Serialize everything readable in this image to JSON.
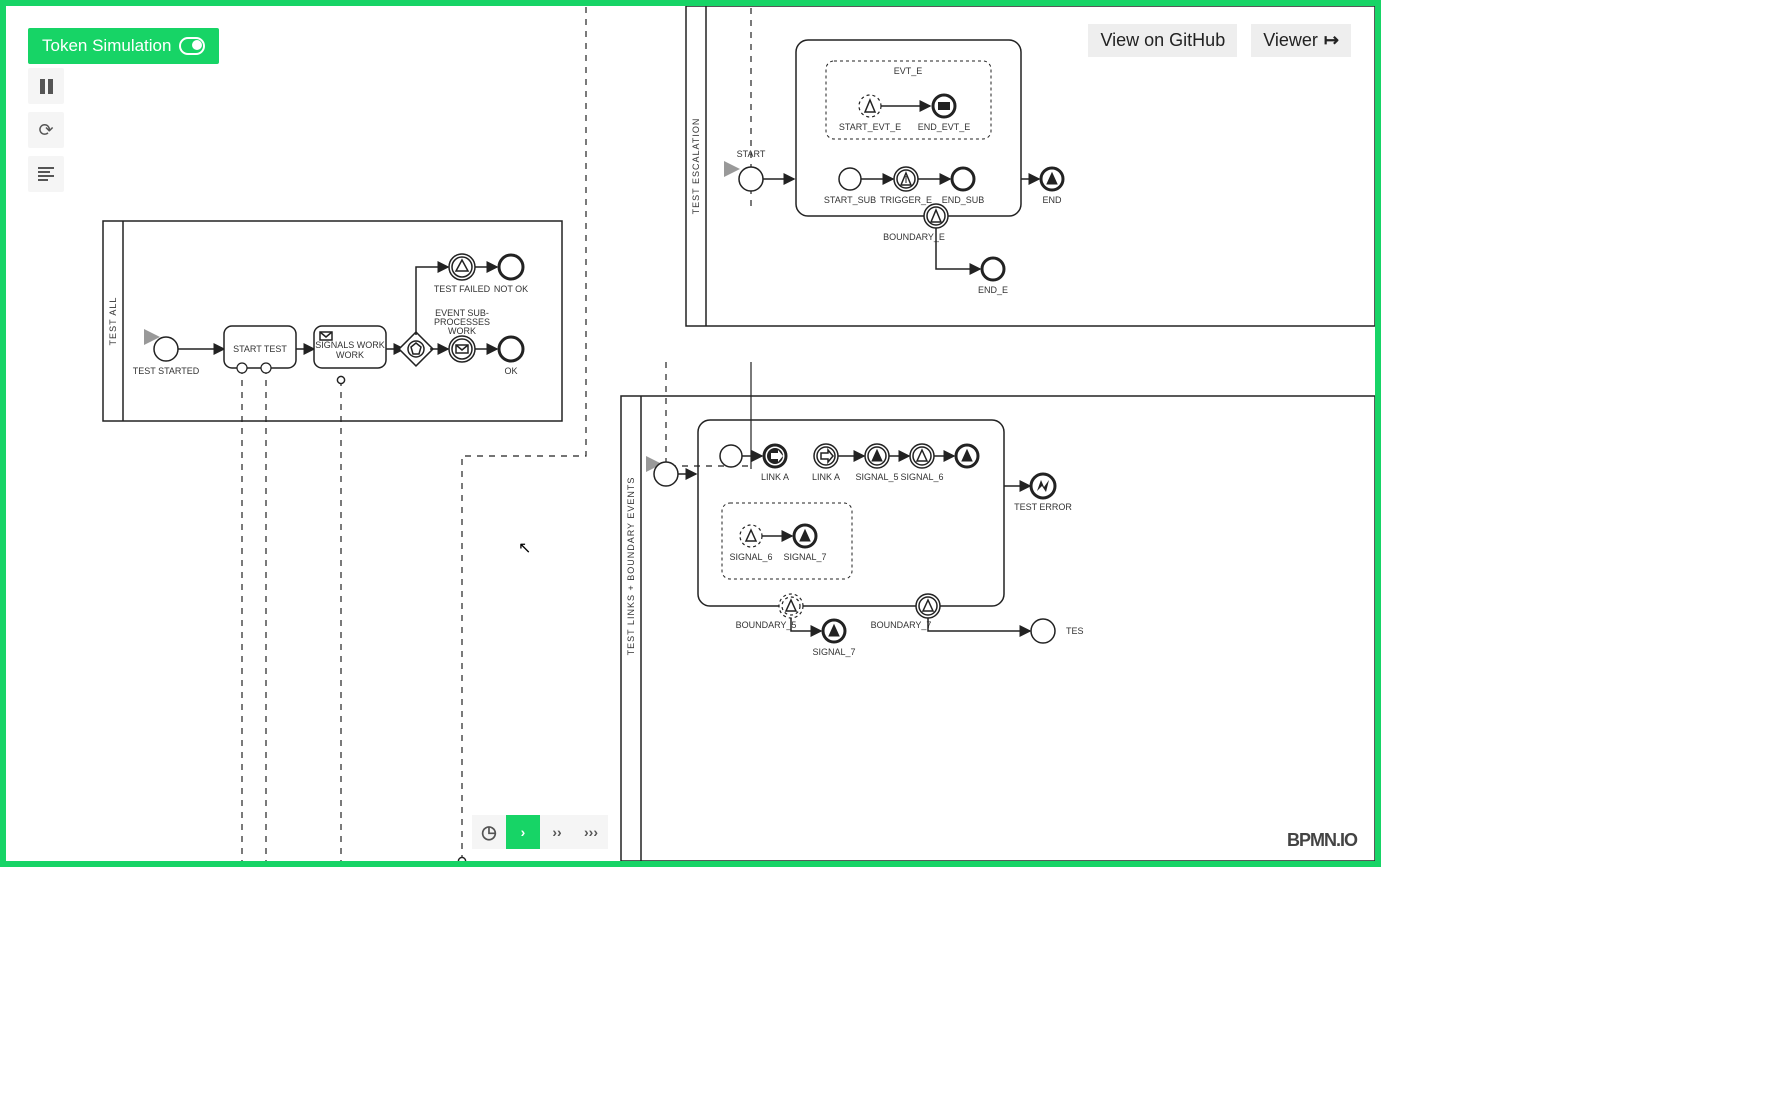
{
  "header": {
    "token_sim": "Token Simulation",
    "view_github": "View on GitHub",
    "viewer": "Viewer"
  },
  "controls": {
    "pause": "pause",
    "refresh": "refresh",
    "log": "log"
  },
  "speed": {
    "gauge": "gauge",
    "s1": "›",
    "s2": "››",
    "s3": "›››"
  },
  "logo": "BPMN.IO",
  "lanes": {
    "test_all": "TEST ALL",
    "test_esc": "TEST ESCALATION",
    "test_links": "TEST LINKS + BOUNDARY EVENTS"
  },
  "testall": {
    "start": "TEST STARTED",
    "task1": "START TEST",
    "task2": "SIGNALS WORK",
    "test_failed": "TEST FAILED",
    "not_ok": "NOT OK",
    "sub_label1": "EVENT SUB-",
    "sub_label2": "PROCESSES",
    "sub_label3": "WORK",
    "ok": "OK"
  },
  "esc": {
    "evt_e": "EVT_E",
    "start_evt_e": "START_EVT_E",
    "end_evt_e": "END_EVT_E",
    "start": "START",
    "start_sub": "START_SUB",
    "trigger_e": "TRIGGER_E",
    "end_sub": "END_SUB",
    "end": "END",
    "boundary_e": "BOUNDARY_E",
    "end_e": "END_E"
  },
  "links": {
    "link_a1": "LINK A",
    "link_a2": "LINK A",
    "signal_5": "SIGNAL_5",
    "signal_6": "SIGNAL_6",
    "signal_6b": "SIGNAL_6",
    "signal_7": "SIGNAL_7",
    "signal_7b": "SIGNAL_7",
    "test_error": "TEST ERROR",
    "boundary_5": "BOUNDARY_5",
    "boundary_7": "BOUNDARY_7",
    "tes": "TES"
  }
}
